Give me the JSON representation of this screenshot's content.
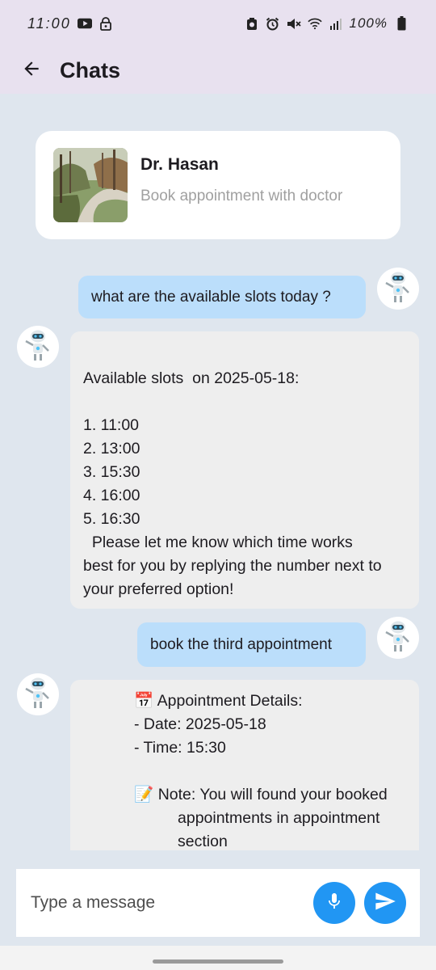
{
  "status_bar": {
    "time": "11:00",
    "battery": "100%"
  },
  "app_bar": {
    "title": "Chats"
  },
  "doctor_card": {
    "name": "Dr. Hasan",
    "subtitle": "Book appointment with doctor"
  },
  "messages": [
    {
      "sender": "user",
      "text": "what are the available slots today ?"
    },
    {
      "sender": "bot",
      "lines": [
        "",
        "Available slots  on 2025-05-18:",
        "",
        "1. 11:00",
        "2. 13:00",
        "3. 15:30",
        "4. 16:00",
        "5. 16:30",
        "  Please let me know which time works",
        "best for you by replying the number next to",
        "your preferred option!"
      ]
    },
    {
      "sender": "user",
      "text": "book the third appointment"
    },
    {
      "sender": "bot",
      "lines": [
        "📅 Appointment Details:",
        "- Date: 2025-05-18",
        "- Time: 15:30",
        "",
        "📝 Note: You will found your booked",
        "appointments in appointment",
        "section"
      ]
    }
  ],
  "composer": {
    "placeholder": "Type a message"
  },
  "icons": {
    "back": "arrow-left-icon",
    "mic": "microphone-icon",
    "send": "send-icon",
    "avatar": "robot-icon"
  },
  "colors": {
    "accent": "#2196f3",
    "user_bubble": "#bbdefb",
    "bot_bubble": "#eeeeee",
    "background": "#dfe6ee",
    "app_bar": "#e8e1ef"
  }
}
